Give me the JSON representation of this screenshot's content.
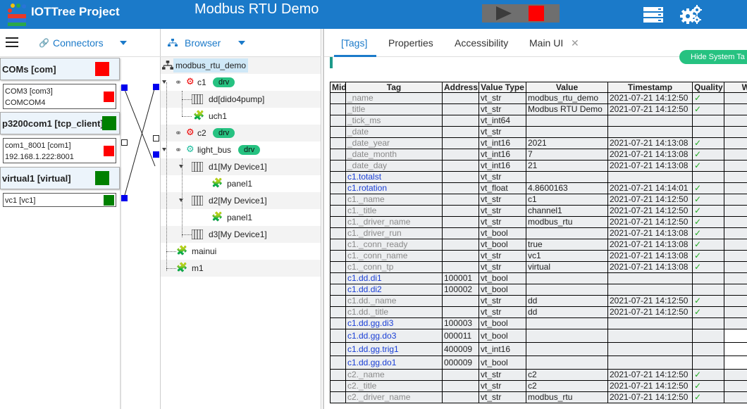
{
  "app": {
    "brand": "IOTTree Project",
    "title": "Modbus RTU Demo"
  },
  "colors": {
    "topbar": "#1b7ac9",
    "accent": "#1b7ac9",
    "badge": "#26c281",
    "stop": "#ff0000",
    "ok": "#008000"
  },
  "icons": {
    "play": "play-icon",
    "stop": "stop-icon",
    "server": "server-icon",
    "gears": "gears-icon"
  },
  "connectors": {
    "title": "Connectors",
    "groups": [
      {
        "label": "COMs [com]",
        "status_color": "#ff0000",
        "items": [
          {
            "label": "COM3 [com3]\nCOMCOM4",
            "status_color": "#ff0000"
          }
        ]
      },
      {
        "label": "p3200com1 [tcp_client]",
        "status_color": "#008000",
        "items": [
          {
            "label": "com1_8001 [com1]\n192.168.1.222:8001",
            "status_color": "#ff0000"
          }
        ]
      },
      {
        "label": "virtual1 [virtual]",
        "status_color": "#008000",
        "items": [
          {
            "label": "vc1 [vc1]",
            "status_color": "#008000"
          }
        ]
      }
    ]
  },
  "browser": {
    "title": "Browser",
    "nodes": [
      {
        "label": "modbus_rtu_demo"
      },
      {
        "label": "c1",
        "badge": "drv"
      },
      {
        "label": "dd[dido4pump]"
      },
      {
        "label": "uch1"
      },
      {
        "label": "c2",
        "badge": "drv"
      },
      {
        "label": "light_bus",
        "badge": "drv"
      },
      {
        "label": "d1[My Device1]"
      },
      {
        "label": "panel1"
      },
      {
        "label": "d2[My Device1]"
      },
      {
        "label": "panel1"
      },
      {
        "label": "d3[My Device1]"
      },
      {
        "label": "mainui"
      },
      {
        "label": "m1"
      }
    ]
  },
  "tabs": [
    {
      "label": "[Tags]"
    },
    {
      "label": "Properties"
    },
    {
      "label": "Accessibility"
    },
    {
      "label": "Main UI"
    }
  ],
  "hide_button": "Hide System Ta",
  "table": {
    "headers": [
      "Mid",
      "Tag",
      "Address",
      "Value Type",
      "Value",
      "Timestamp",
      "Quality",
      "W"
    ],
    "rows": [
      {
        "tag": "_name",
        "addr": "",
        "type": "vt_str",
        "value": "modbus_rtu_demo",
        "ts": "2021-07-21 14:12:50",
        "q": "✓",
        "sys": true
      },
      {
        "tag": "_title",
        "addr": "",
        "type": "vt_str",
        "value": "Modbus RTU Demo",
        "ts": "2021-07-21 14:12:50",
        "q": "✓",
        "sys": true
      },
      {
        "tag": "_tick_ms",
        "addr": "",
        "type": "vt_int64",
        "value": "",
        "ts": "",
        "q": "",
        "sys": true
      },
      {
        "tag": "_date",
        "addr": "",
        "type": "vt_str",
        "value": "",
        "ts": "",
        "q": "",
        "sys": true
      },
      {
        "tag": "_date_year",
        "addr": "",
        "type": "vt_int16",
        "value": "2021",
        "ts": "2021-07-21 14:13:08",
        "q": "✓",
        "sys": true
      },
      {
        "tag": "_date_month",
        "addr": "",
        "type": "vt_int16",
        "value": "7",
        "ts": "2021-07-21 14:13:08",
        "q": "✓",
        "sys": true
      },
      {
        "tag": "_date_day",
        "addr": "",
        "type": "vt_int16",
        "value": "21",
        "ts": "2021-07-21 14:13:08",
        "q": "✓",
        "sys": true
      },
      {
        "tag": "c1.totalst",
        "addr": "",
        "type": "vt_str",
        "value": "",
        "ts": "",
        "q": "",
        "sys": false
      },
      {
        "tag": "c1.rotation",
        "addr": "",
        "type": "vt_float",
        "value": "4.8600163",
        "ts": "2021-07-21 14:14:01",
        "q": "✓",
        "sys": false
      },
      {
        "tag": "c1._name",
        "addr": "",
        "type": "vt_str",
        "value": "c1",
        "ts": "2021-07-21 14:12:50",
        "q": "✓",
        "sys": true
      },
      {
        "tag": "c1._title",
        "addr": "",
        "type": "vt_str",
        "value": "channel1",
        "ts": "2021-07-21 14:12:50",
        "q": "✓",
        "sys": true
      },
      {
        "tag": "c1._driver_name",
        "addr": "",
        "type": "vt_str",
        "value": "modbus_rtu",
        "ts": "2021-07-21 14:12:50",
        "q": "✓",
        "sys": true
      },
      {
        "tag": "c1._driver_run",
        "addr": "",
        "type": "vt_bool",
        "value": "",
        "ts": "2021-07-21 14:13:08",
        "q": "✓",
        "sys": true
      },
      {
        "tag": "c1._conn_ready",
        "addr": "",
        "type": "vt_bool",
        "value": "true",
        "ts": "2021-07-21 14:13:08",
        "q": "✓",
        "sys": true
      },
      {
        "tag": "c1._conn_name",
        "addr": "",
        "type": "vt_str",
        "value": "vc1",
        "ts": "2021-07-21 14:13:08",
        "q": "✓",
        "sys": true
      },
      {
        "tag": "c1._conn_tp",
        "addr": "",
        "type": "vt_str",
        "value": "virtual",
        "ts": "2021-07-21 14:13:08",
        "q": "✓",
        "sys": true
      },
      {
        "tag": "c1.dd.di1",
        "addr": "100001",
        "type": "vt_bool",
        "value": "",
        "ts": "",
        "q": "",
        "sys": false
      },
      {
        "tag": "c1.dd.di2",
        "addr": "100002",
        "type": "vt_bool",
        "value": "",
        "ts": "",
        "q": "",
        "sys": false
      },
      {
        "tag": "c1.dd._name",
        "addr": "",
        "type": "vt_str",
        "value": "dd",
        "ts": "2021-07-21 14:12:50",
        "q": "✓",
        "sys": true
      },
      {
        "tag": "c1.dd._title",
        "addr": "",
        "type": "vt_str",
        "value": "dd",
        "ts": "2021-07-21 14:12:50",
        "q": "✓",
        "sys": true
      },
      {
        "tag": "c1.dd.gg.di3",
        "addr": "100003",
        "type": "vt_bool",
        "value": "",
        "ts": "",
        "q": "",
        "sys": false
      },
      {
        "tag": "c1.dd.gg.do3",
        "addr": "000011",
        "type": "vt_bool",
        "value": "",
        "ts": "",
        "q": "",
        "sys": false,
        "tall": true
      },
      {
        "tag": "c1.dd.gg.trig1",
        "addr": "400009",
        "type": "vt_int16",
        "value": "",
        "ts": "",
        "q": "",
        "sys": false,
        "tall": true
      },
      {
        "tag": "c1.dd.gg.do1",
        "addr": "000009",
        "type": "vt_bool",
        "value": "",
        "ts": "",
        "q": "",
        "sys": false,
        "tall": true
      },
      {
        "tag": "c2._name",
        "addr": "",
        "type": "vt_str",
        "value": "c2",
        "ts": "2021-07-21 14:12:50",
        "q": "✓",
        "sys": true
      },
      {
        "tag": "c2._title",
        "addr": "",
        "type": "vt_str",
        "value": "c2",
        "ts": "2021-07-21 14:12:50",
        "q": "✓",
        "sys": true
      },
      {
        "tag": "c2._driver_name",
        "addr": "",
        "type": "vt_str",
        "value": "modbus_rtu",
        "ts": "2021-07-21 14:12:50",
        "q": "✓",
        "sys": true
      }
    ]
  }
}
